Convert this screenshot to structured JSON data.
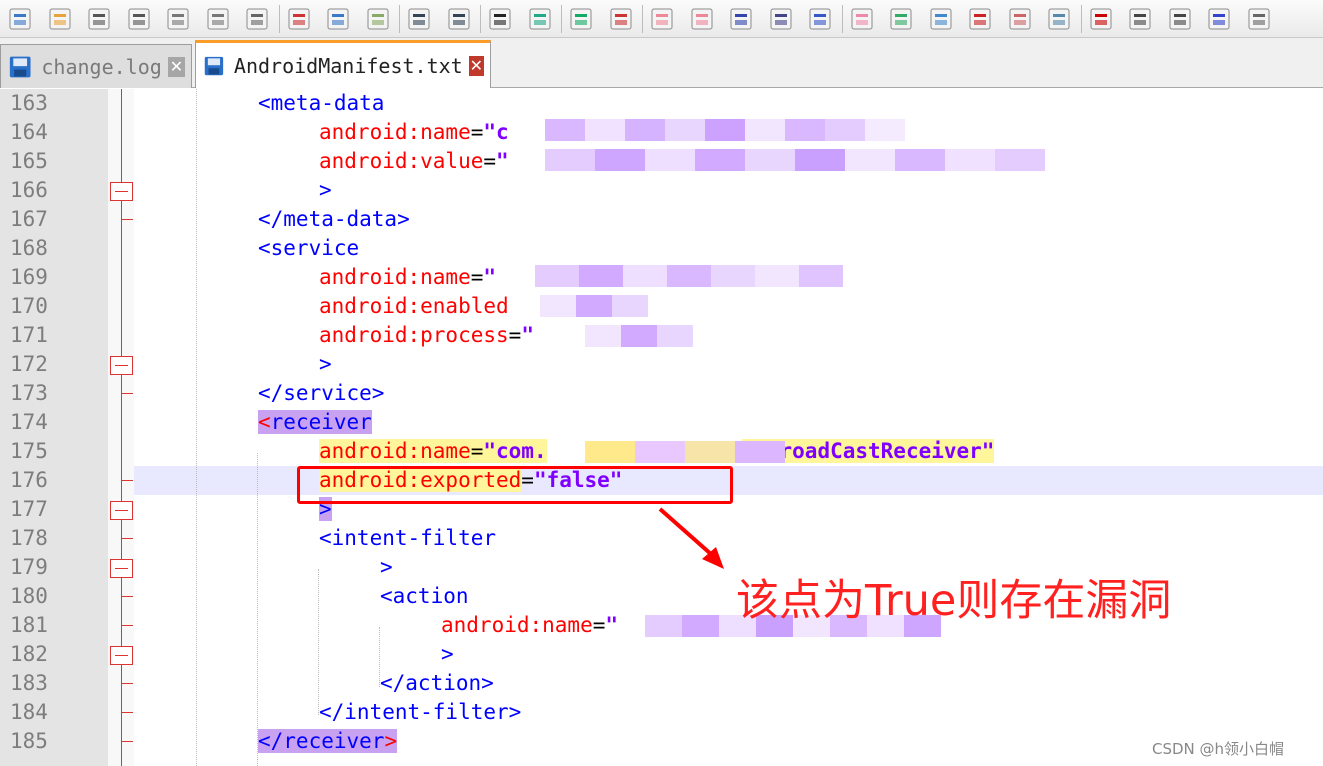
{
  "toolbar": {
    "buttons": [
      {
        "name": "new-file-icon"
      },
      {
        "name": "open-file-icon"
      },
      {
        "name": "save-icon"
      },
      {
        "name": "save-all-icon"
      },
      {
        "name": "close-icon"
      },
      {
        "name": "close-all-icon"
      },
      {
        "name": "print-icon"
      },
      {
        "name": "cut-icon"
      },
      {
        "name": "copy-icon"
      },
      {
        "name": "paste-icon"
      },
      {
        "name": "undo-icon"
      },
      {
        "name": "redo-icon"
      },
      {
        "name": "find-icon"
      },
      {
        "name": "replace-icon"
      },
      {
        "name": "zoom-in-icon"
      },
      {
        "name": "zoom-out-icon"
      },
      {
        "name": "sync-vertical-icon"
      },
      {
        "name": "sync-horizontal-icon"
      },
      {
        "name": "word-wrap-icon"
      },
      {
        "name": "show-all-chars-icon"
      },
      {
        "name": "indent-guide-icon"
      },
      {
        "name": "language-icon"
      },
      {
        "name": "doc-map-icon"
      },
      {
        "name": "doc-list-icon"
      },
      {
        "name": "function-list-icon"
      },
      {
        "name": "folder-workspace-icon"
      },
      {
        "name": "monitor-icon"
      },
      {
        "name": "record-macro-icon"
      },
      {
        "name": "stop-macro-icon"
      },
      {
        "name": "play-macro-icon"
      },
      {
        "name": "run-macro-multiple-icon"
      },
      {
        "name": "save-macro-icon"
      }
    ]
  },
  "tabs": [
    {
      "label": "change.log",
      "active": false
    },
    {
      "label": "AndroidManifest.txt",
      "active": true
    }
  ],
  "editor": {
    "lines": [
      {
        "num": "163",
        "parts": [
          [
            "tag",
            "<meta-data"
          ]
        ]
      },
      {
        "num": "164",
        "parts": [
          [
            "attr",
            "android:name"
          ],
          [
            "plain",
            "="
          ],
          [
            "val",
            "\"c"
          ]
        ]
      },
      {
        "num": "165",
        "parts": [
          [
            "attr",
            "android:value"
          ],
          [
            "plain",
            "="
          ],
          [
            "val",
            "\""
          ]
        ]
      },
      {
        "num": "166",
        "parts": [
          [
            "tag",
            ">"
          ]
        ]
      },
      {
        "num": "167",
        "parts": [
          [
            "tag",
            "</meta-data>"
          ]
        ]
      },
      {
        "num": "168",
        "parts": [
          [
            "tag",
            "<service"
          ]
        ]
      },
      {
        "num": "169",
        "parts": [
          [
            "attr",
            "android:name"
          ],
          [
            "plain",
            "="
          ],
          [
            "val",
            "\""
          ]
        ]
      },
      {
        "num": "170",
        "parts": [
          [
            "attr",
            "android:enabled"
          ]
        ]
      },
      {
        "num": "171",
        "parts": [
          [
            "attr",
            "android:process"
          ],
          [
            "plain",
            "="
          ],
          [
            "val",
            "\""
          ]
        ]
      },
      {
        "num": "172",
        "parts": [
          [
            "tag",
            ">"
          ]
        ]
      },
      {
        "num": "173",
        "parts": [
          [
            "tag",
            "</service>"
          ]
        ]
      },
      {
        "num": "174",
        "parts": [
          [
            "bracket",
            "<"
          ],
          [
            "tag",
            "receiver"
          ]
        ]
      },
      {
        "num": "175",
        "parts": [
          [
            "attr",
            "android:name"
          ],
          [
            "plain",
            "="
          ],
          [
            "val",
            "\"com."
          ],
          [
            "gap",
            ""
          ],
          [
            "val",
            "MyBroadCastReceiver\""
          ]
        ]
      },
      {
        "num": "176",
        "parts": [
          [
            "attr",
            "android:exported"
          ],
          [
            "plain",
            "="
          ],
          [
            "val",
            "\"false\""
          ]
        ]
      },
      {
        "num": "177",
        "parts": [
          [
            "tag",
            ">"
          ]
        ]
      },
      {
        "num": "178",
        "parts": [
          [
            "tag",
            "<intent-filter"
          ]
        ]
      },
      {
        "num": "179",
        "parts": [
          [
            "tag",
            ">"
          ]
        ]
      },
      {
        "num": "180",
        "parts": [
          [
            "tag",
            "<action"
          ]
        ]
      },
      {
        "num": "181",
        "parts": [
          [
            "attr",
            "android:name"
          ],
          [
            "plain",
            "="
          ],
          [
            "val",
            "\""
          ]
        ]
      },
      {
        "num": "182",
        "parts": [
          [
            "tag",
            ">"
          ]
        ]
      },
      {
        "num": "183",
        "parts": [
          [
            "tag",
            "</action>"
          ]
        ]
      },
      {
        "num": "184",
        "parts": [
          [
            "tag",
            "</intent-filter>"
          ]
        ]
      },
      {
        "num": "185",
        "parts": [
          [
            "tag",
            "</receiver"
          ],
          [
            "bracket",
            ">"
          ]
        ]
      }
    ]
  },
  "annotation": {
    "text": "该点为True则存在漏洞"
  },
  "watermark": "CSDN @h领小白帽",
  "colors": {
    "tag": "#0000ff",
    "attribute": "#ff0000",
    "value": "#8000ff",
    "annotation": "#ff2020",
    "tab_active_accent": "#fa9c2a"
  }
}
